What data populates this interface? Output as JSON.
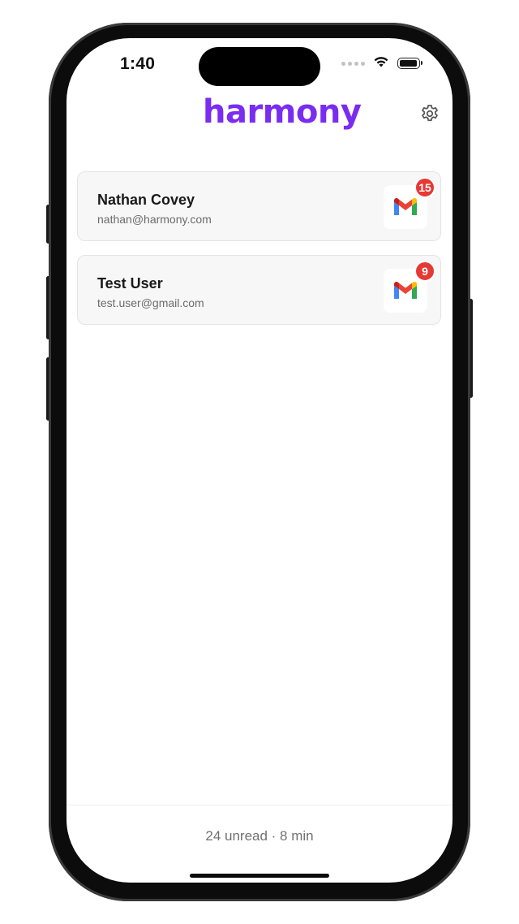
{
  "status_bar": {
    "time": "1:40"
  },
  "header": {
    "brand": "harmony",
    "brand_color": "#7a2cf0",
    "settings_icon": "gear-icon"
  },
  "accounts": [
    {
      "name": "Nathan Covey",
      "email": "nathan@harmony.com",
      "provider_icon": "gmail-icon",
      "unread": "15"
    },
    {
      "name": "Test User",
      "email": "test.user@gmail.com",
      "provider_icon": "gmail-icon",
      "unread": "9"
    }
  ],
  "footer": {
    "summary": "24 unread · 8 min"
  },
  "colors": {
    "badge": "#e53935",
    "card_bg": "#f7f7f7"
  }
}
